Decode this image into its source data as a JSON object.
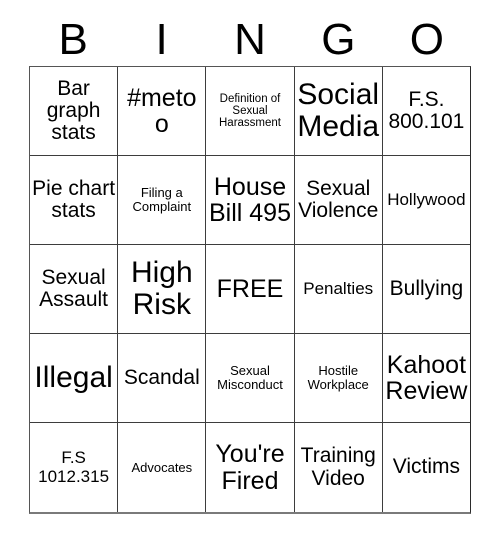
{
  "card": {
    "title": "BINGO",
    "header_letters": [
      "B",
      "I",
      "N",
      "G",
      "O"
    ],
    "rows": 5,
    "columns": 5,
    "free_space_label": "FREE",
    "free_space_position": {
      "row": 3,
      "column": 3
    },
    "colors": {
      "background": "#ffffff",
      "text": "#000000",
      "grid_line": "#3d3d3d",
      "outer_border": "#555555"
    },
    "grid": [
      [
        {
          "text": "Bar graph stats",
          "size": "md"
        },
        {
          "text": "#metoo",
          "size": "lg"
        },
        {
          "text": "Definition of Sexual Harassment",
          "size": "xxs"
        },
        {
          "text": "Social Media",
          "size": "xl"
        },
        {
          "text": "F.S. 800.101",
          "size": "md"
        }
      ],
      [
        {
          "text": "Pie chart stats",
          "size": "md"
        },
        {
          "text": "Filing a Complaint",
          "size": "xs"
        },
        {
          "text": "House Bill 495",
          "size": "lg"
        },
        {
          "text": "Sexual Violence",
          "size": "md"
        },
        {
          "text": "Hollywood",
          "size": "sm"
        }
      ],
      [
        {
          "text": "Sexual Assault",
          "size": "md"
        },
        {
          "text": "High Risk",
          "size": "xl"
        },
        {
          "text": "FREE",
          "size": "lg"
        },
        {
          "text": "Penalties",
          "size": "sm"
        },
        {
          "text": "Bullying",
          "size": "md"
        }
      ],
      [
        {
          "text": "Illegal",
          "size": "xl"
        },
        {
          "text": "Scandal",
          "size": "md"
        },
        {
          "text": "Sexual Misconduct",
          "size": "xs"
        },
        {
          "text": "Hostile Workplace",
          "size": "xs"
        },
        {
          "text": "Kahoot Review",
          "size": "lg"
        }
      ],
      [
        {
          "text": "F.S 1012.315",
          "size": "sm"
        },
        {
          "text": "Advocates",
          "size": "xs"
        },
        {
          "text": "You're Fired",
          "size": "lg"
        },
        {
          "text": "Training Video",
          "size": "md"
        },
        {
          "text": "Victims",
          "size": "md"
        }
      ]
    ]
  }
}
